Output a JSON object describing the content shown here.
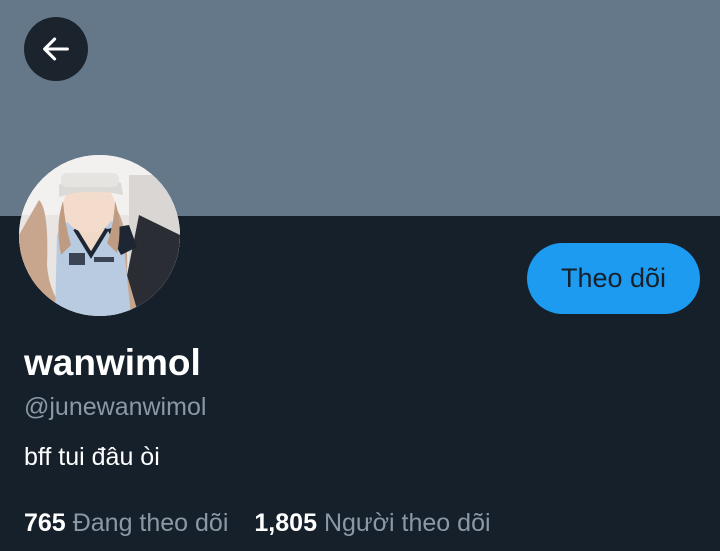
{
  "profile": {
    "display_name": "wanwimol",
    "handle": "@junewanwimol",
    "bio": "bff tui đâu òi",
    "follow_button_label": "Theo dõi"
  },
  "stats": {
    "following_count": "765",
    "following_label": "Đang theo dõi",
    "followers_count": "1,805",
    "followers_label": "Người theo dõi"
  },
  "icons": {
    "back": "arrow-left-icon"
  },
  "colors": {
    "background": "#15202b",
    "banner": "#65788a",
    "accent": "#1d9bf0",
    "secondary_text": "#8b98a5"
  }
}
